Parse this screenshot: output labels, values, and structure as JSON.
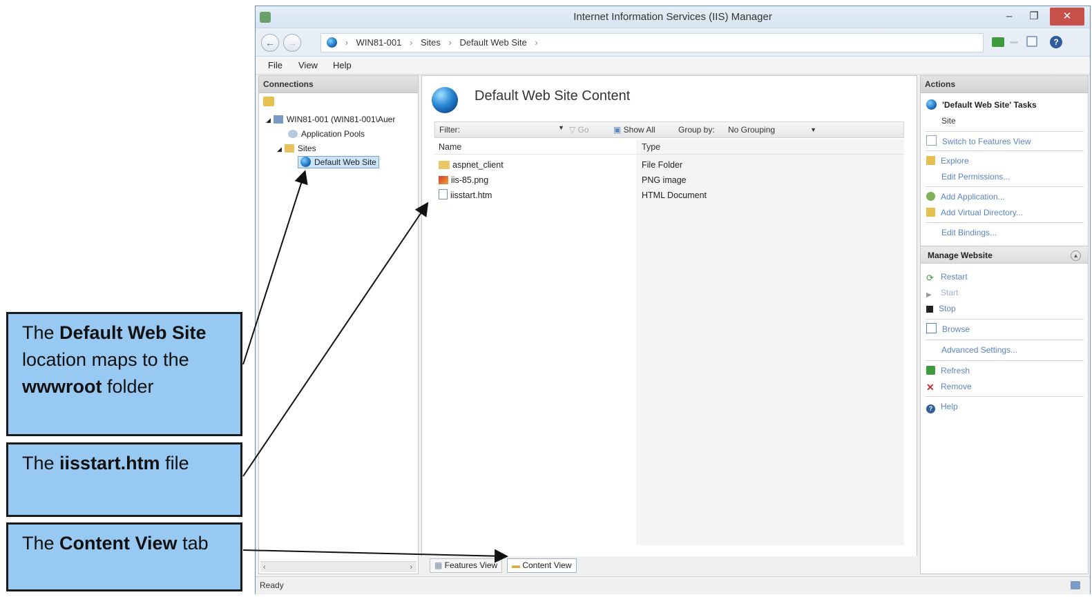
{
  "window": {
    "title": "Internet Information Services (IIS) Manager",
    "controls": {
      "minimize": "–",
      "restore": "❐",
      "close": "✕"
    }
  },
  "address_bar": {
    "crumbs": [
      "WIN81-001",
      "Sites",
      "Default Web Site"
    ],
    "separator": "›"
  },
  "menu": [
    "File",
    "View",
    "Help"
  ],
  "connections": {
    "header": "Connections",
    "tree": {
      "server": "WIN81-001 (WIN81-001\\Auer",
      "app_pools": "Application Pools",
      "sites": "Sites",
      "site": "Default Web Site"
    }
  },
  "content": {
    "title": "Default Web Site Content",
    "filter_label": "Filter:",
    "go_label": "Go",
    "show_all_label": "Show All",
    "group_by_label": "Group by:",
    "group_by_value": "No Grouping",
    "columns": {
      "name": "Name",
      "type": "Type"
    },
    "rows": [
      {
        "name": "aspnet_client",
        "type": "File Folder",
        "icon": "folder-icon"
      },
      {
        "name": "iis-85.png",
        "type": "PNG image",
        "icon": "image-icon"
      },
      {
        "name": "iisstart.htm",
        "type": "HTML Document",
        "icon": "html-file-icon"
      }
    ],
    "tabs": {
      "features": "Features View",
      "content": "Content View"
    }
  },
  "actions": {
    "header": "Actions",
    "tasks_title": "'Default Web Site' Tasks",
    "site_label": "Site",
    "items": [
      "Switch to Features View",
      "Explore",
      "Edit Permissions...",
      "Add Application...",
      "Add Virtual Directory...",
      "Edit Bindings..."
    ],
    "manage_header": "Manage Website",
    "manage_items": [
      "Restart",
      "Start",
      "Stop"
    ],
    "browse": "Browse",
    "advanced": "Advanced Settings...",
    "refresh": "Refresh",
    "remove": "Remove",
    "help": "Help"
  },
  "status": "Ready",
  "annotations": {
    "site_callout": {
      "t1": "The ",
      "b1": "Default Web Site",
      "t2": " location maps to the ",
      "b2": "wwwroot",
      "t3": " folder"
    },
    "file_callout": {
      "t1": "The ",
      "b1": "iisstart.htm",
      "t2": " file"
    },
    "tab_callout": {
      "t1": "The ",
      "b1": "Content View",
      "t2": " tab"
    }
  },
  "colors": {
    "accent": "#5b85c3",
    "callout_bg": "#98c9f2",
    "close": "#c7504b"
  }
}
